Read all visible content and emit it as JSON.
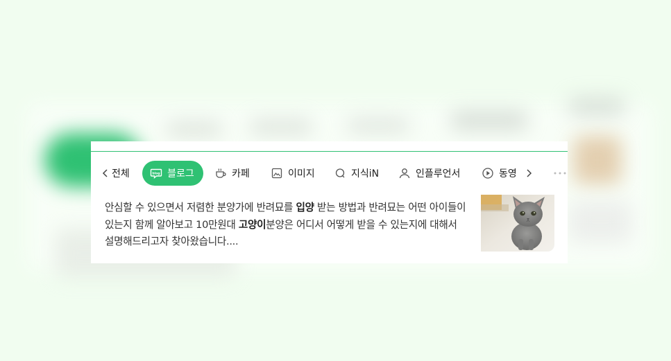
{
  "tabs": {
    "all": "전체",
    "blog": "블로그",
    "cafe": "카페",
    "image": "이미지",
    "kin": "지식iN",
    "influencer": "인플루언서",
    "video": "동영"
  },
  "snippet": {
    "part1": "안심할 수 있으면서 저렴한 분양가에 반려묘를 ",
    "highlight1": "입양",
    "part2": " 받는 방법과 반려묘는 어떤 아이들이 있는지 함께 알아보고 10만원대 ",
    "highlight2": "고양이",
    "part3": "분양은 어디서 어떻게 받을 수 있는지에 대해서 설명해드리고자 찾아왔습니다...."
  },
  "colors": {
    "accent": "#2fc173",
    "background": "#f1fdf0"
  },
  "icons": [
    "chevron-left-icon",
    "blog-icon",
    "cafe-icon",
    "image-icon",
    "kin-icon",
    "user-icon",
    "play-icon",
    "chevron-right-icon",
    "more-icon"
  ]
}
